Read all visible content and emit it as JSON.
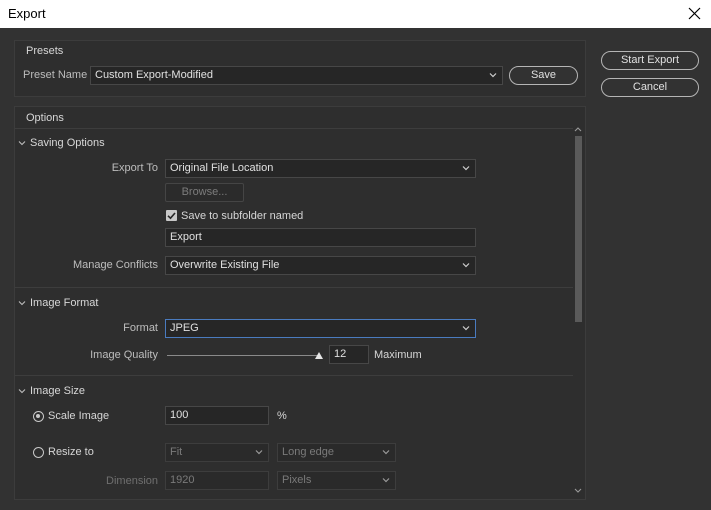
{
  "window": {
    "title": "Export"
  },
  "presets": {
    "heading": "Presets",
    "preset_name_label": "Preset Name",
    "preset_value": "Custom Export-Modified",
    "save_label": "Save"
  },
  "actions": {
    "start_export_label": "Start Export",
    "cancel_label": "Cancel"
  },
  "options": {
    "heading": "Options",
    "saving": {
      "heading": "Saving Options",
      "export_to_label": "Export To",
      "export_to_value": "Original File Location",
      "browse_label": "Browse...",
      "subfolder_checked": true,
      "subfolder_label": "Save to subfolder named",
      "subfolder_value": "Export",
      "manage_conflicts_label": "Manage Conflicts",
      "manage_conflicts_value": "Overwrite Existing File"
    },
    "image_format": {
      "heading": "Image Format",
      "format_label": "Format",
      "format_value": "JPEG",
      "quality_label": "Image Quality",
      "quality_value": "12",
      "quality_text": "Maximum",
      "quality_fraction": 1.0
    },
    "image_size": {
      "heading": "Image Size",
      "scale_label": "Scale Image",
      "scale_selected": true,
      "scale_value": "100",
      "scale_unit": "%",
      "resize_label": "Resize to",
      "resize_mode": "Fit",
      "resize_edge": "Long edge",
      "dimension_label": "Dimension",
      "dimension_value": "1920",
      "dimension_unit": "Pixels"
    }
  },
  "colors": {
    "accent_focus": "#4a7bbf",
    "background": "#323232"
  }
}
